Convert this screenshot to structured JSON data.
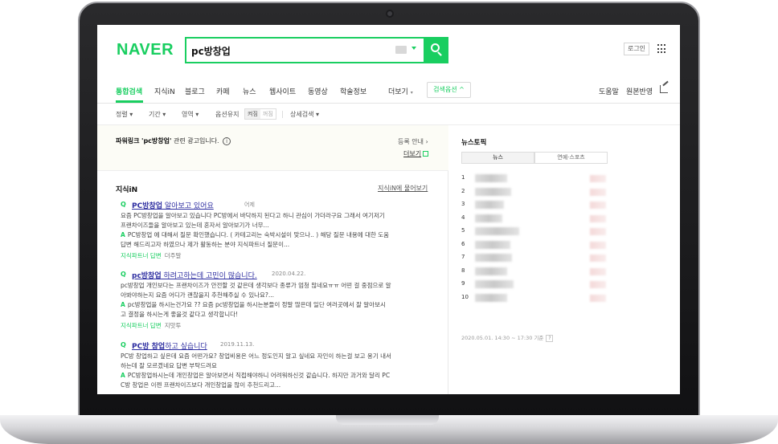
{
  "header": {
    "logo": "NAVER",
    "search_value": "pc방창업",
    "login_label": "로그인"
  },
  "tabs": {
    "items": [
      {
        "label": "통합검색",
        "active": true
      },
      {
        "label": "지식iN"
      },
      {
        "label": "블로그"
      },
      {
        "label": "카페"
      },
      {
        "label": "뉴스"
      },
      {
        "label": "웹사이트"
      },
      {
        "label": "동영상"
      },
      {
        "label": "학술정보"
      },
      {
        "label": "더보기"
      }
    ],
    "search_option": "검색옵션",
    "right": [
      "도움말",
      "원본반영"
    ]
  },
  "filters": {
    "sort": "정렬",
    "period": "기간",
    "area": "영역",
    "option_keep": "옵션유지",
    "toggle_on": "켜짐",
    "toggle_off": "꺼짐",
    "advanced": "상세검색"
  },
  "powerlink": {
    "label": "파워링크",
    "query_quote": "'pc방창업'",
    "suffix": "관련 광고입니다.",
    "register": "등록 안내 ›",
    "more": "더보기"
  },
  "kin": {
    "heading": "지식iN",
    "ask_link": "지식iN에 물어보기",
    "items": [
      {
        "title_bold": "PC방창업",
        "title_rest": " 알아보고 있어요",
        "date": "어제",
        "q_lines": [
          "요즘 PC방창업을 알아보고 있습니다 PC방에서 바닥하지 된다고 하니 관심이 가더라구요 그래서 여기저기",
          "프랜차이즈들을 알아보고 있는데 혼자서 알아보기가 너무..."
        ],
        "a_lines": [
          "PC방창업 에 대해서 질문 확인했습니다. ( 카테고리는 숙박시설이 맞으나.. ) 해당 질문 내용에 대한 도움",
          "답변 해드리고자 하였으나 제가 활동하는 분야 지식파트너 질문이..."
        ],
        "foot": "지식파트너 답변",
        "foot_grey": "더주말"
      },
      {
        "title_bold": "pc방창업",
        "title_rest": " 하려고하는데 고민이 많습니다.",
        "date": "2020.04.22.",
        "q_lines": [
          "pc방창업 개인보다는 프랜차이즈가 안전할 것 같은데 생각보다 종류가 엄청 많네요ㅠㅠ 어떤 걸 중점으로 알",
          "아봐야하는지 요즘 어디가 괜찮을지 추천해주실 수 있나요?..."
        ],
        "a_lines": [
          "pc방창업을 하시는건가요 ?? 요즘 pc방창업을 하시는분들이 정말 많은데 일단 여러곳에서 잘 알아보시",
          "고 결정을 하시는게 좋을것 같다고 생각합니다!"
        ],
        "foot": "지식파트너 답변",
        "foot_grey": "지맛투"
      },
      {
        "title_bold": "PC방 창업",
        "title_rest": "하고 싶습니다",
        "date": "2019.11.13.",
        "q_lines": [
          "PC방 창업하고 싶은데 요즘 어떤가요? 창업비용은 어느 정도인지 알고 싶네요 자인이 하는걸 보고 용기 내서",
          "하는데 잘 모르겠네요 답변 부탁드려요"
        ],
        "a_lines": [
          "PC방창업하시는데 개인창업은 알아보면서 직접해야하니 어려워하신것 같습니다. 하지만 과거와 달리 PC",
          "C방 창업은 이젠 프랜차이즈보다 개인창업을 많이 추천드리고..."
        ],
        "foot": "",
        "foot_grey": ""
      }
    ]
  },
  "news": {
    "heading": "뉴스토픽",
    "tabs": [
      "뉴스",
      "연예·스포츠"
    ],
    "ranks": [
      "1",
      "2",
      "3",
      "4",
      "5",
      "6",
      "7",
      "8",
      "9",
      "10"
    ],
    "timestamp": "2020.05.01. 14:30 ~ 17:30 기준",
    "help": "?"
  }
}
